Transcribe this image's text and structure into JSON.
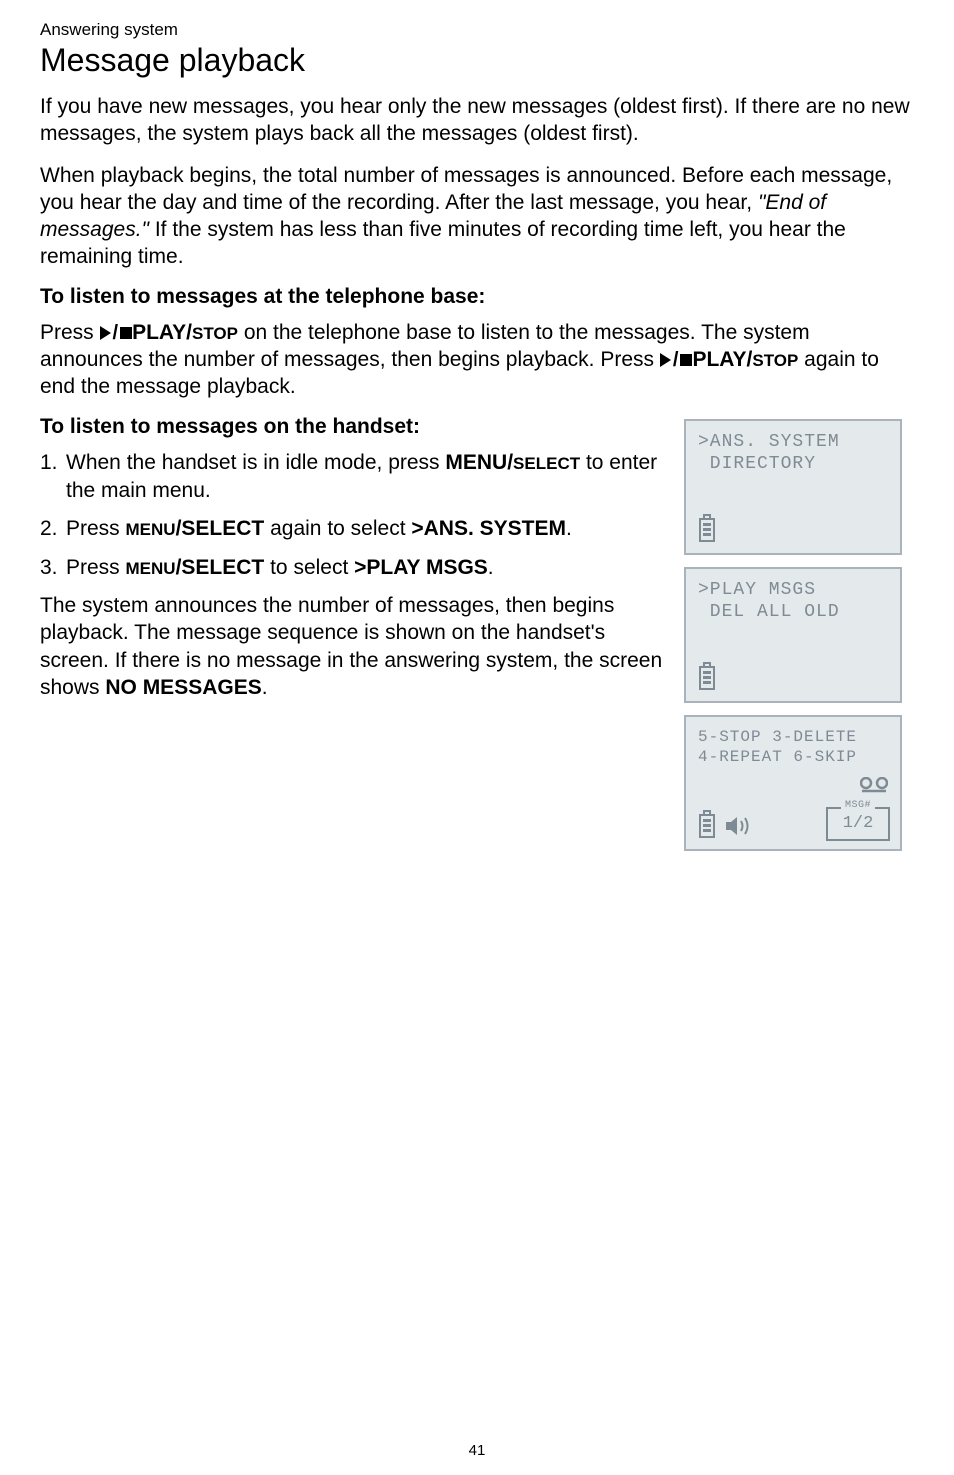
{
  "breadcrumb": "Answering system",
  "title": "Message playback",
  "para1": "If you have new messages, you hear only the new messages (oldest first). If there are no new messages, the system plays back all the messages (oldest first).",
  "para2_a": "When playback begins, the total number of messages is announced. Before each message, you hear the day and time of the recording. After the last message, you hear, ",
  "para2_quote": "\"End of messages.\"",
  "para2_b": " If the system has less than five minutes of recording time left, you hear the remaining time.",
  "heading1": "To listen to messages at the telephone base:",
  "p3_a": "Press ",
  "playstop1": "PLAY/",
  "playstop1b": "STOP",
  "p3_b": " on the telephone base to listen to the messages. The system announces the number of messages, then begins playback. Press ",
  "playstop2": "PLAY/",
  "playstop2b": "STOP",
  "p3_c": " again to end the message playback.",
  "heading2": "To listen to messages on the handset:",
  "steps": [
    {
      "num": "1.",
      "a": "When the handset is in idle mode, press ",
      "k1": "MENU/",
      "k1s": "SELECT",
      "b": " to enter the main menu."
    },
    {
      "num": "2.",
      "a": "Press ",
      "k0s": "MENU",
      "k0": "/SELECT",
      "b": " again to select ",
      "k2": ">ANS. SYSTEM",
      "c": "."
    },
    {
      "num": "3.",
      "a": "Press ",
      "k0s": "MENU",
      "k0": "/SELECT",
      "b": " to select ",
      "k2": ">PLAY MSGS",
      "c": "."
    }
  ],
  "para4_a": "The system announces the number of messages, then begins playback. The message sequence is shown on the handset's screen. If there is no message in the answering system, the screen shows ",
  "para4_b": "NO MESSAGES",
  "para4_c": ".",
  "screens": [
    {
      "l1": ">ANS. SYSTEM",
      "l2": " DIRECTORY"
    },
    {
      "l1": ">PLAY MSGS",
      "l2": " DEL ALL OLD"
    },
    {
      "l1": "5-STOP 3-DELETE",
      "l2": "4-REPEAT 6-SKIP",
      "msglbl": "MSG#",
      "msgval": "1/2",
      "tape": "ºº"
    }
  ],
  "page": "41"
}
